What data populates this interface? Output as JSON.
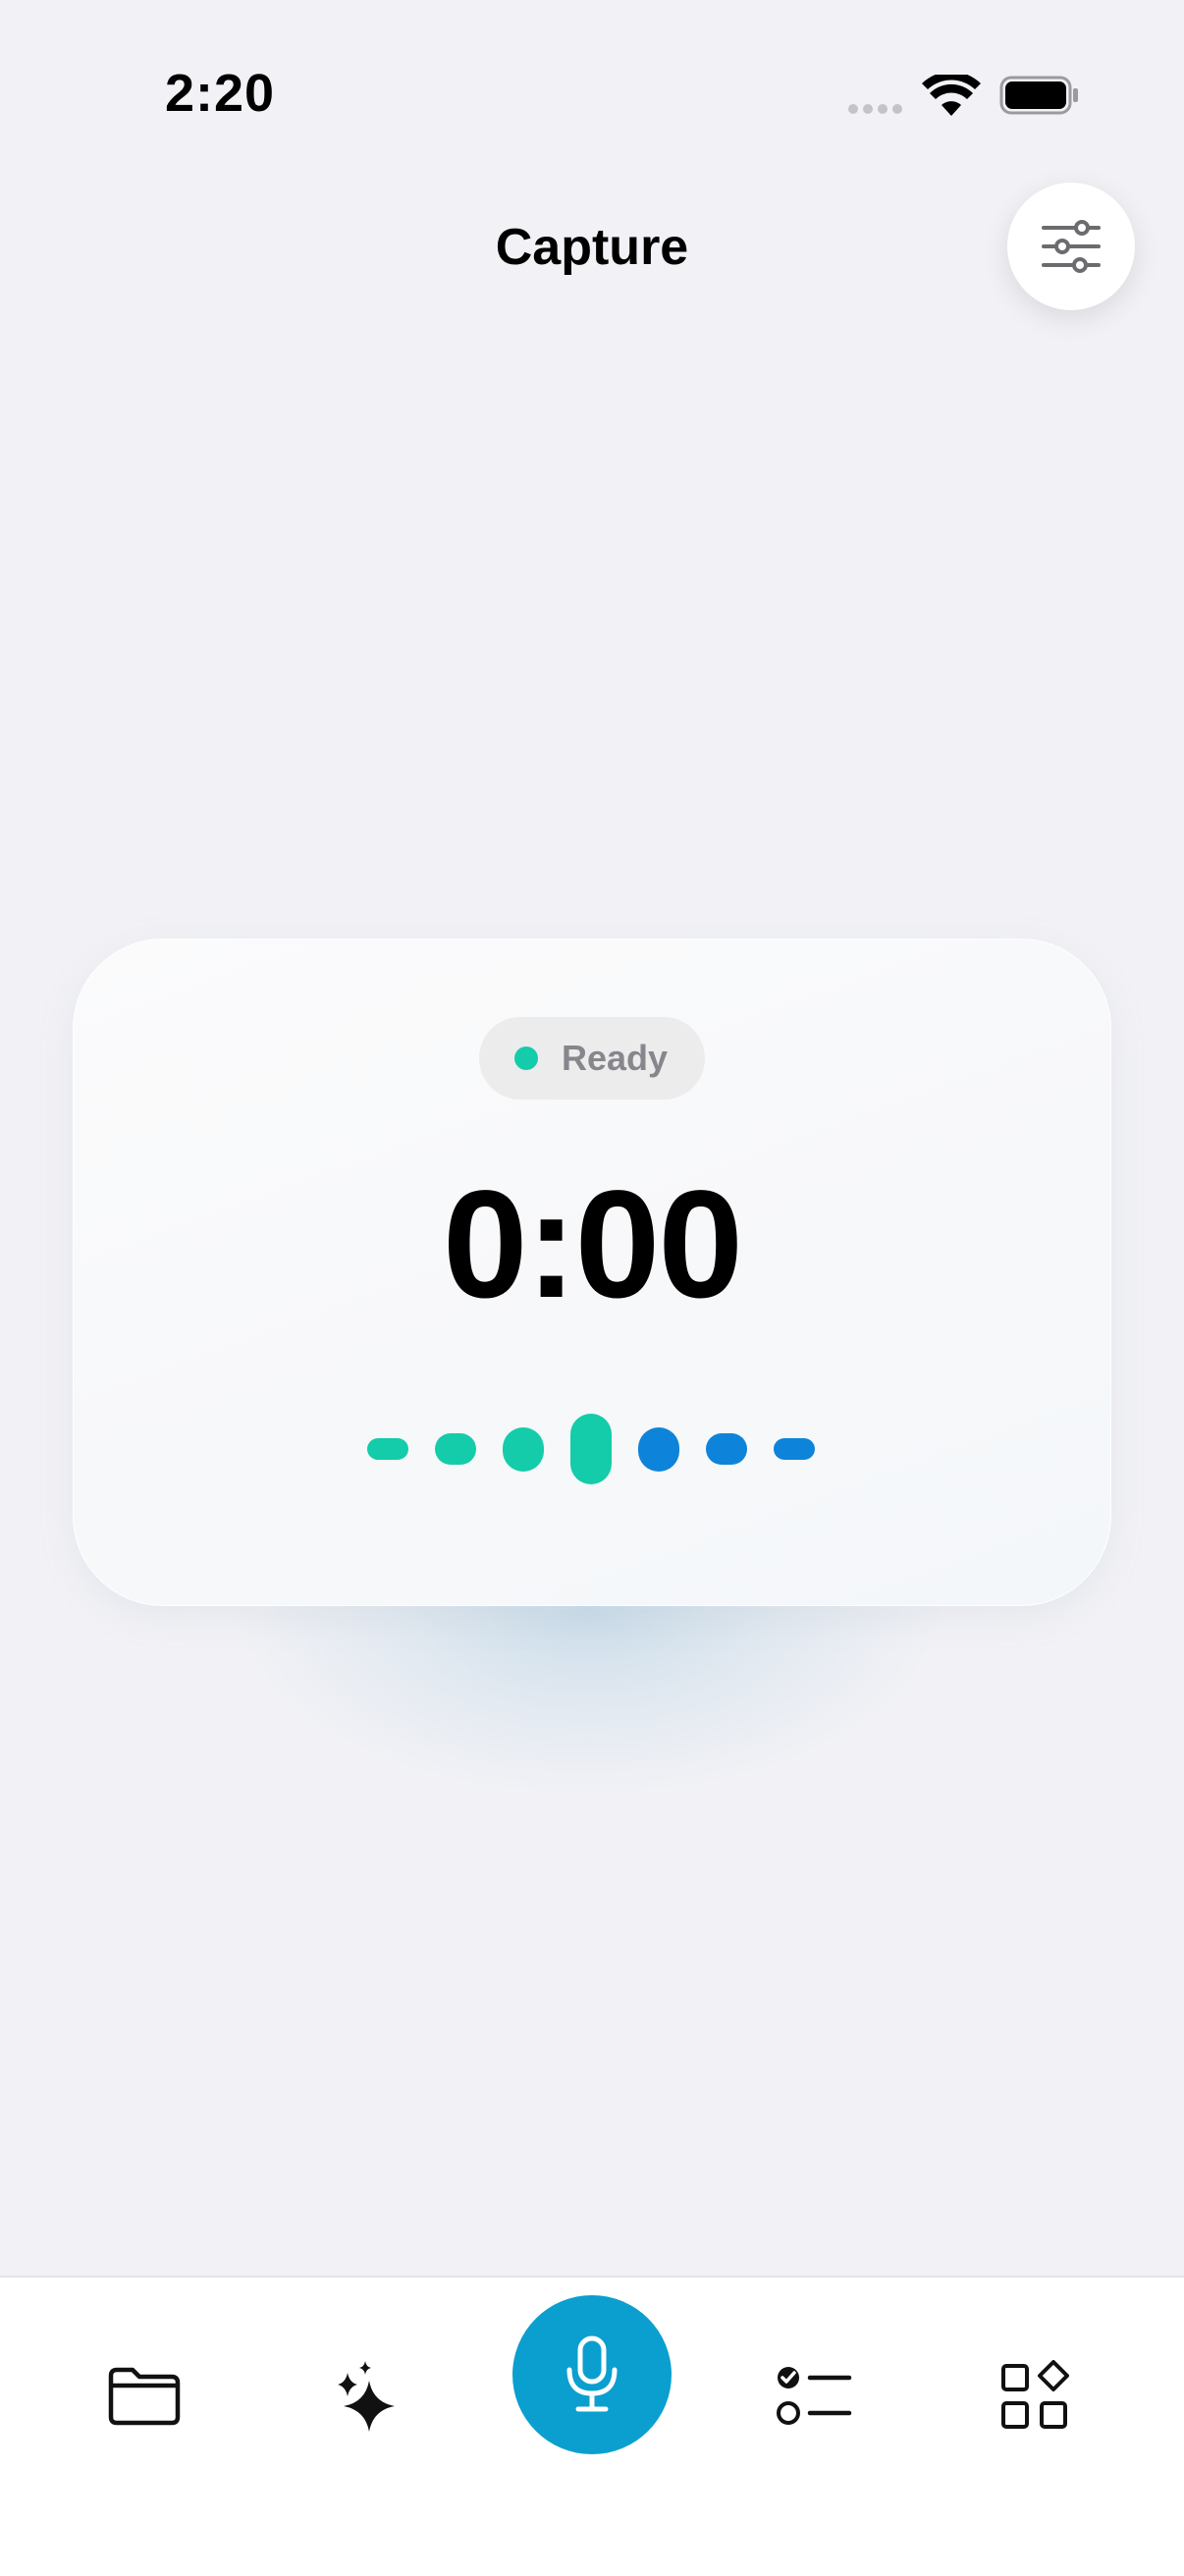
{
  "status_bar": {
    "time": "2:20"
  },
  "header": {
    "title": "Capture"
  },
  "card": {
    "status_label": "Ready",
    "timer": "0:00"
  },
  "waveform": {
    "bars": [
      {
        "level": 0.28,
        "color": "#14ccaa"
      },
      {
        "level": 0.45,
        "color": "#14ccaa"
      },
      {
        "level": 0.62,
        "color": "#14ccaa"
      },
      {
        "level": 1.0,
        "color": "#14ccaa"
      },
      {
        "level": 0.62,
        "color": "#0d84d9"
      },
      {
        "level": 0.45,
        "color": "#0d84d9"
      },
      {
        "level": 0.28,
        "color": "#0d84d9"
      }
    ]
  },
  "colors": {
    "accent": "#0a9fce",
    "ready_green": "#14ccaa",
    "wave_blue": "#0d84d9",
    "background": "#f2f2f6"
  },
  "tab_bar": {
    "items": [
      {
        "icon": "folder-icon"
      },
      {
        "icon": "sparkles-icon"
      },
      {
        "icon": "microphone-icon",
        "selected": true
      },
      {
        "icon": "checklist-icon"
      },
      {
        "icon": "grid-shapes-icon"
      }
    ]
  }
}
